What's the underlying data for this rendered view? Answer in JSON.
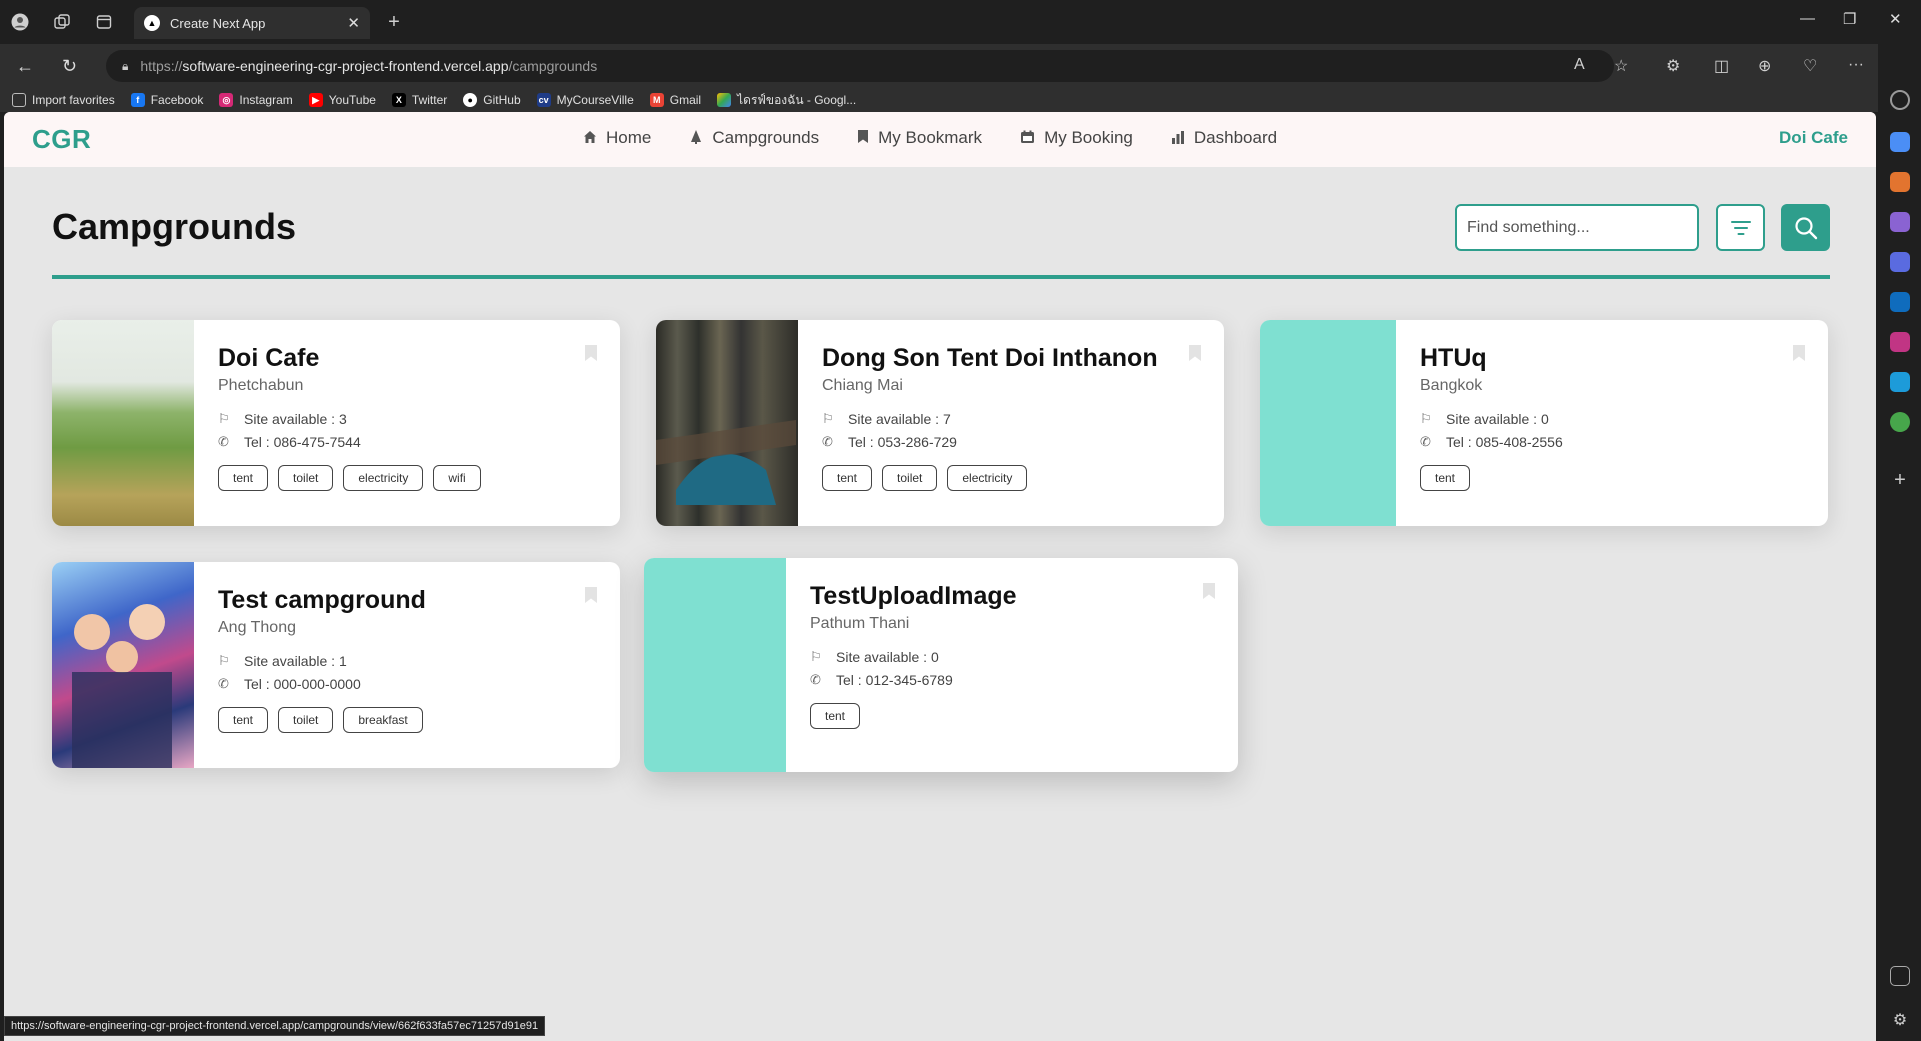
{
  "browser": {
    "tab_title": "Create Next App",
    "url_scheme": "https://",
    "url_host": "software-engineering-cgr-project-frontend.vercel.app",
    "url_path": "/campgrounds",
    "status_url": "https://software-engineering-cgr-project-frontend.vercel.app/campgrounds/view/662f633fa57ec71257d91e91",
    "favorites": [
      {
        "label": "Import favorites",
        "icon": "import-icon",
        "color": "#555555"
      },
      {
        "label": "Facebook",
        "icon": "facebook-icon",
        "color": "#1877f2"
      },
      {
        "label": "Instagram",
        "icon": "instagram-icon",
        "color": "#d62976"
      },
      {
        "label": "YouTube",
        "icon": "youtube-icon",
        "color": "#ff0000"
      },
      {
        "label": "Twitter",
        "icon": "x-icon",
        "color": "#000000"
      },
      {
        "label": "GitHub",
        "icon": "github-icon",
        "color": "#333333"
      },
      {
        "label": "MyCourseVille",
        "icon": "mycourseville-icon",
        "color": "#1f3c88"
      },
      {
        "label": "Gmail",
        "icon": "gmail-icon",
        "color": "#ea4335"
      },
      {
        "label": "ไดรฟ์ของฉัน - Googl...",
        "icon": "google-drive-icon",
        "color": "#34a853"
      }
    ]
  },
  "app": {
    "logo": "CGR",
    "nav": [
      {
        "label": "Home",
        "icon": "home-icon"
      },
      {
        "label": "Campgrounds",
        "icon": "campground-icon"
      },
      {
        "label": "My Bookmark",
        "icon": "bookmark-icon"
      },
      {
        "label": "My Booking",
        "icon": "booking-icon"
      },
      {
        "label": "Dashboard",
        "icon": "dashboard-icon"
      }
    ],
    "user_label": "Doi Cafe",
    "accent_color": "#2e9e8c"
  },
  "main": {
    "title": "Campgrounds",
    "search_placeholder": "Find something..."
  },
  "campgrounds": [
    {
      "name": "Doi Cafe",
      "location": "Phetchabun",
      "site_label": "Site available : 3",
      "tel_label": "Tel : 086-475-7544",
      "tags": [
        "tent",
        "toilet",
        "electricity",
        "wifi"
      ],
      "image": "photo"
    },
    {
      "name": "Dong Son Tent Doi Inthanon",
      "location": "Chiang Mai",
      "site_label": "Site available : 7",
      "tel_label": "Tel : 053-286-729",
      "tags": [
        "tent",
        "toilet",
        "electricity"
      ],
      "image": "photo"
    },
    {
      "name": "HTUq",
      "location": "Bangkok",
      "site_label": "Site available : 0",
      "tel_label": "Tel : 085-408-2556",
      "tags": [
        "tent"
      ],
      "image": "placeholder"
    },
    {
      "name": "Test campground",
      "location": "Ang Thong",
      "site_label": "Site available : 1",
      "tel_label": "Tel : 000-000-0000",
      "tags": [
        "tent",
        "toilet",
        "breakfast"
      ],
      "image": "photo"
    },
    {
      "name": "TestUploadImage",
      "location": "Pathum Thani",
      "site_label": "Site available : 0",
      "tel_label": "Tel : 012-345-6789",
      "tags": [
        "tent"
      ],
      "image": "placeholder"
    }
  ]
}
